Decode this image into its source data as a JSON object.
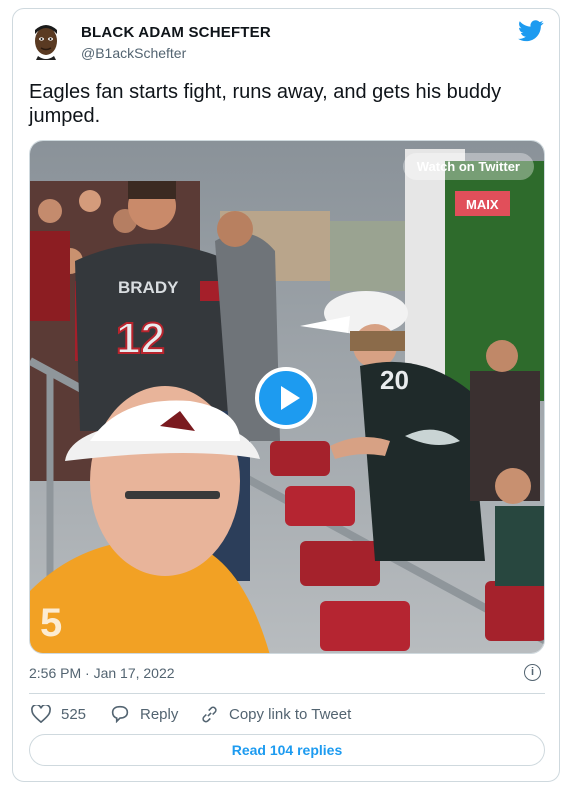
{
  "author": {
    "name": "BLACK ADAM SCHEFTER",
    "handle": "@B1ackSchefter"
  },
  "tweet": {
    "text": "Eagles fan starts fight, runs away, and gets his buddy jumped."
  },
  "media": {
    "watch_label": "Watch on Twitter",
    "jersey_left_name": "BRADY",
    "jersey_left_number": "12",
    "jersey_right_number": "20",
    "billboard_text": "MAIX"
  },
  "meta": {
    "timestamp": "2:56 PM · Jan 17, 2022",
    "info_icon": "i"
  },
  "actions": {
    "likes": "525",
    "reply_label": "Reply",
    "copy_label": "Copy link to Tweet"
  },
  "footer": {
    "read_replies": "Read 104 replies"
  },
  "colors": {
    "accent": "#1d9bf0",
    "secondary_text": "#536471",
    "border": "#cfd9de"
  }
}
